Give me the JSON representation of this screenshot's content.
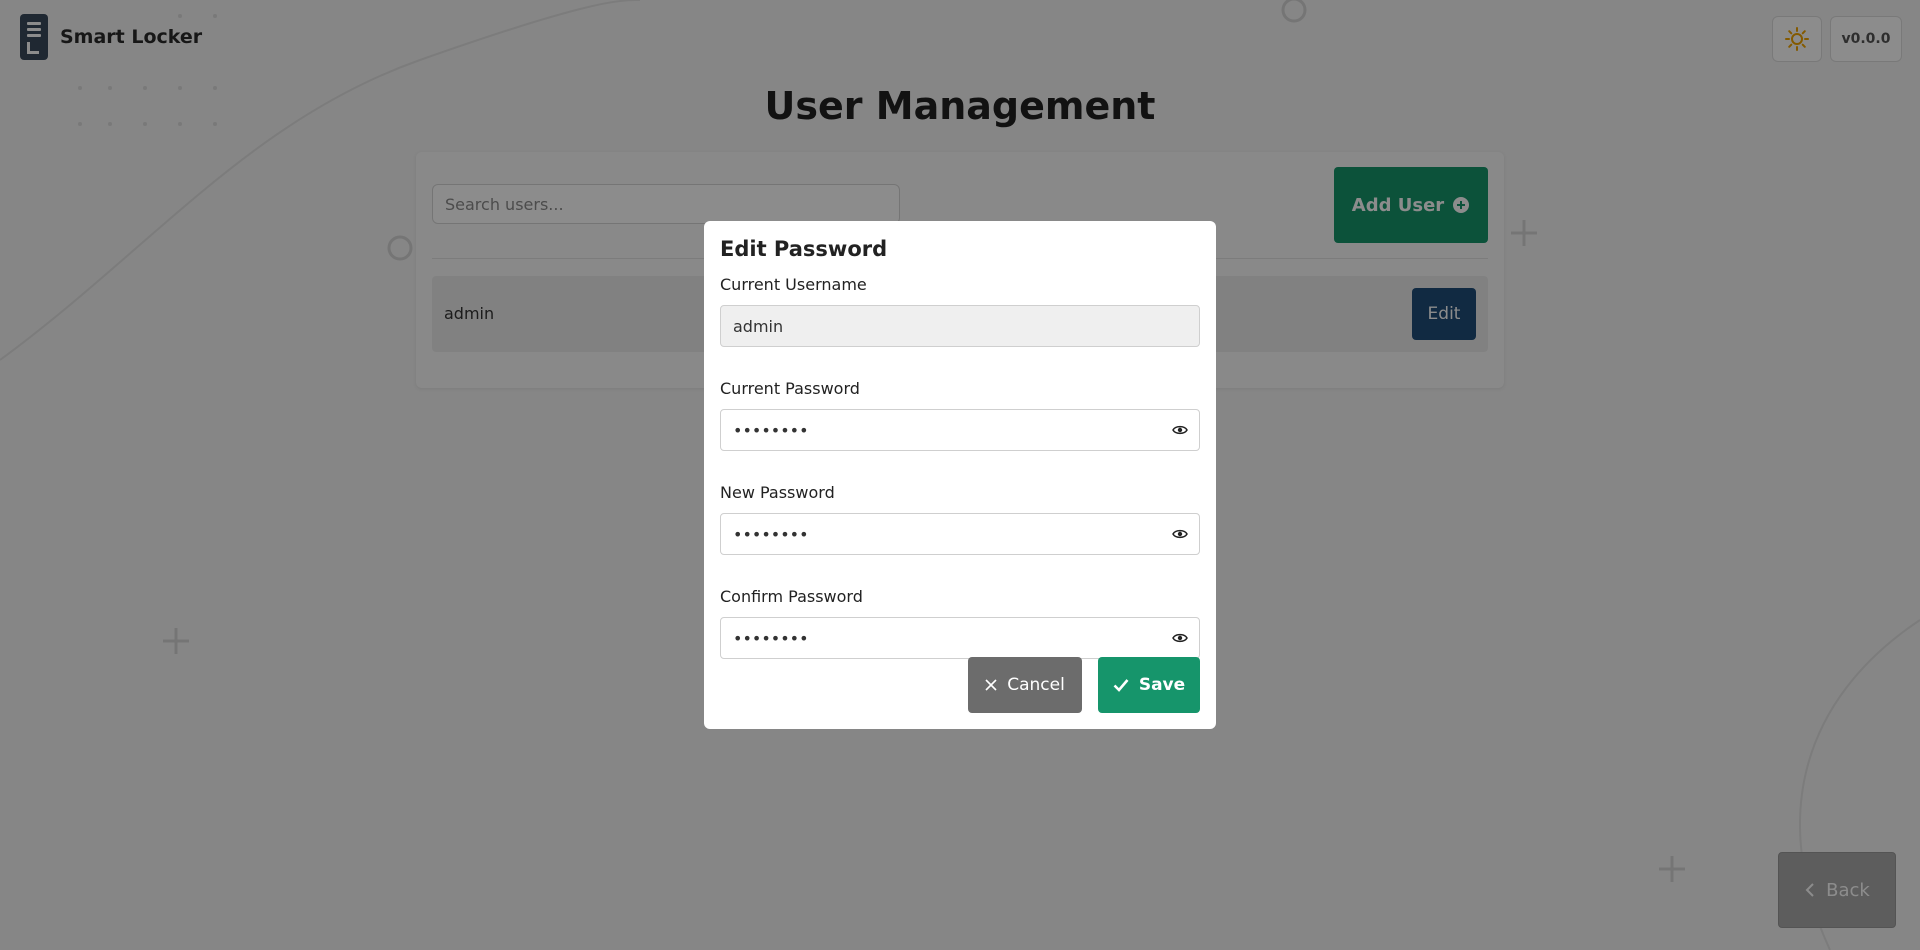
{
  "header": {
    "app_title": "Smart Locker",
    "logo_icon": "locker-logo-icon",
    "theme_icon": "sun-icon",
    "version": "v0.0.0"
  },
  "page": {
    "title": "User Management"
  },
  "panel": {
    "search_placeholder": "Search users...",
    "add_user_label": "Add User",
    "add_user_icon": "plus-circle-icon",
    "users": [
      {
        "name": "admin",
        "edit_label": "Edit"
      }
    ]
  },
  "back_button": {
    "label": "Back",
    "icon": "chevron-left-icon"
  },
  "modal": {
    "title": "Edit Password",
    "username_label": "Current Username",
    "username_value": "admin",
    "current_password_label": "Current Password",
    "current_password_value": "••••••••",
    "new_password_label": "New Password",
    "new_password_value": "••••••••",
    "confirm_password_label": "Confirm Password",
    "confirm_password_value": "••••••••",
    "toggle_icon": "eye-icon",
    "cancel_label": "Cancel",
    "cancel_icon": "close-icon",
    "save_label": "Save",
    "save_icon": "check-icon"
  },
  "colors": {
    "primary_green": "#16956b",
    "edit_blue": "#1f4e79",
    "cancel_gray": "#6c6c6c",
    "overlay": "rgba(0,0,0,0.45)"
  }
}
